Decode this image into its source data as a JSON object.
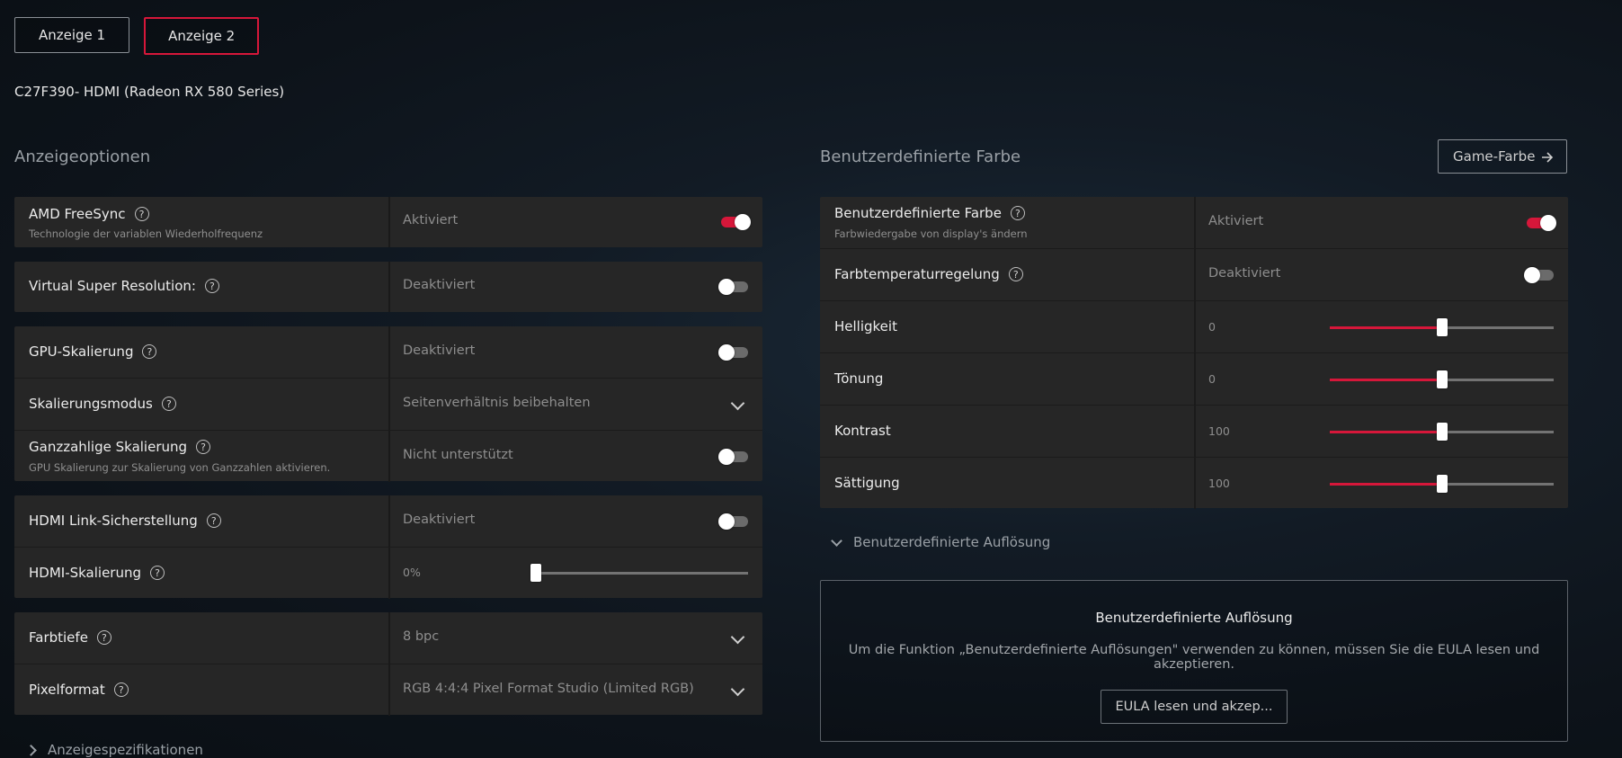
{
  "tabs": [
    "Anzeige 1",
    "Anzeige 2"
  ],
  "device_name": "C27F390- HDMI (Radeon RX 580 Series)",
  "display_options": {
    "title": "Anzeigeoptionen",
    "freesync": {
      "label": "AMD FreeSync",
      "sub": "Technologie der variablen Wiederholfrequenz",
      "value": "Aktiviert",
      "on": true
    },
    "vsr": {
      "label": "Virtual Super Resolution:",
      "value": "Deaktiviert",
      "on": false
    },
    "gpu_scaling": {
      "label": "GPU-Skalierung",
      "value": "Deaktiviert",
      "on": false
    },
    "scaling_mode": {
      "label": "Skalierungsmodus",
      "value": "Seitenverhältnis beibehalten"
    },
    "integer_scaling": {
      "label": "Ganzzahlige Skalierung",
      "sub": "GPU Skalierung zur Skalierung von Ganzzahlen aktivieren.",
      "value": "Nicht unterstützt",
      "on": false
    },
    "hdmi_link": {
      "label": "HDMI Link-Sicherstellung",
      "value": "Deaktiviert",
      "on": false
    },
    "hdmi_scaling": {
      "label": "HDMI-Skalierung",
      "value": "0%",
      "level": 0
    },
    "color_depth": {
      "label": "Farbtiefe",
      "value": "8 bpc"
    },
    "pixel_format": {
      "label": "Pixelformat",
      "value": "RGB 4:4:4 Pixel Format Studio (Limited RGB)"
    },
    "specs_expander": "Anzeigespezifikationen"
  },
  "custom_color": {
    "title": "Benutzerdefinierte Farbe",
    "game_color_button": "Game-Farbe",
    "enable": {
      "label": "Benutzerdefinierte Farbe",
      "sub": "Farbwiedergabe von display's ändern",
      "value": "Aktiviert",
      "on": true
    },
    "temp": {
      "label": "Farbtemperaturregelung",
      "value": "Deaktiviert",
      "on": false
    },
    "brightness": {
      "label": "Helligkeit",
      "value": "0",
      "level": 0.5
    },
    "hue": {
      "label": "Tönung",
      "value": "0",
      "level": 0.5
    },
    "contrast": {
      "label": "Kontrast",
      "value": "100",
      "level": 0.5
    },
    "saturation": {
      "label": "Sättigung",
      "value": "100",
      "level": 0.5
    }
  },
  "custom_resolution": {
    "expander": "Benutzerdefinierte Auflösung",
    "title": "Benutzerdefinierte Auflösung",
    "text": "Um die Funktion „Benutzerdefinierte Auflösungen\" verwenden zu können, müssen Sie die EULA lesen und akzeptieren.",
    "eula_button": "EULA lesen und akzep..."
  },
  "colors": {
    "accent": "#d6173a",
    "card": "#262626",
    "background": "#0d131a"
  },
  "icons": [
    "help-icon",
    "chevron-down-icon",
    "chevron-right-icon",
    "arrow-right-icon"
  ]
}
